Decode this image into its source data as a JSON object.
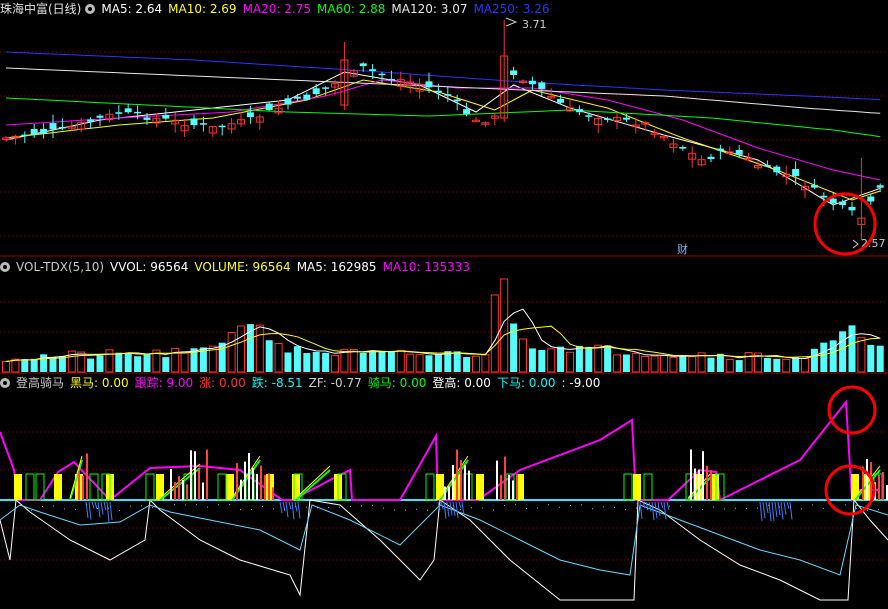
{
  "panel_main": {
    "title": "珠海中富(日线)",
    "ma": [
      {
        "label": "MA5: 2.64",
        "color": "#ffffff"
      },
      {
        "label": "MA10: 2.69",
        "color": "#ffff00"
      },
      {
        "label": "MA20: 2.75",
        "color": "#ff00ff"
      },
      {
        "label": "MA60: 2.88",
        "color": "#00ff00"
      },
      {
        "label": "MA120: 3.07",
        "color": "#e6e6e6"
      },
      {
        "label": "MA250: 3.26",
        "color": "#3030ff"
      }
    ],
    "high_label": "3.71",
    "low_label": "2.57",
    "marker": "财"
  },
  "panel_vol": {
    "title": "VOL-TDX(5,10)",
    "items": [
      {
        "label": "VVOL: 96564",
        "color": "#ffffff"
      },
      {
        "label": "VOLUME: 96564",
        "color": "#ffff00"
      },
      {
        "label": "MA5: 162985",
        "color": "#ffffff"
      },
      {
        "label": "MA10: 135333",
        "color": "#ff00ff"
      }
    ]
  },
  "panel_ind": {
    "title": "登高骑马",
    "items": [
      {
        "label": "黑马: 0.00",
        "color": "#ffff00"
      },
      {
        "label": "跟踪: 9.00",
        "color": "#ff00ff"
      },
      {
        "label": "涨: 0.00",
        "color": "#ff3030"
      },
      {
        "label": "跌: -8.51",
        "color": "#00ffff"
      },
      {
        "label": "ZF: -0.77",
        "color": "#cccccc"
      },
      {
        "label": "骑马: 0.00",
        "color": "#00ff00"
      },
      {
        "label": "登高: 0.00",
        "color": "#ffffff"
      },
      {
        "label": "下马: 0.00",
        "color": "#00ffff"
      },
      {
        "label": ": -9.00",
        "color": "#ffffff"
      }
    ]
  },
  "colors": {
    "up": "#ff3232",
    "down": "#54fcfc",
    "ma5": "#ffffff",
    "ma10": "#ffff00",
    "ma20": "#ff00ff",
    "ma60": "#00ff00",
    "ma120": "#e6e6e6",
    "ma250": "#3030ff",
    "grid": "#800000",
    "circle": "#ff0000"
  },
  "chart_data": {
    "type": "candlestick",
    "series_count": 94,
    "price_range": [
      2.57,
      3.71
    ],
    "last_close": 2.64
  }
}
